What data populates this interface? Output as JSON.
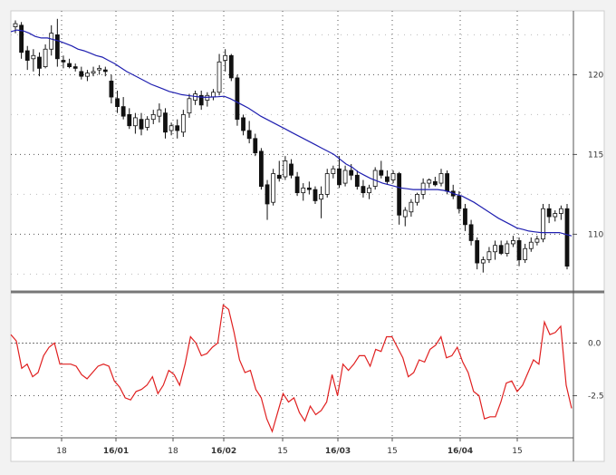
{
  "chart_data": [
    {
      "type": "candlestick",
      "panel": "price",
      "ylim": [
        106.5,
        124
      ],
      "y_ticks": [
        "120",
        "115",
        "110"
      ],
      "y_tick_values": [
        120,
        115,
        110
      ],
      "grid": true,
      "series": [
        {
          "name": "",
          "kind": "candles",
          "ohlc": [
            [
              123.0,
              123.4,
              122.6,
              123.2
            ],
            [
              123.1,
              123.3,
              121.0,
              121.4
            ],
            [
              121.5,
              121.8,
              120.3,
              120.9
            ],
            [
              121.0,
              121.6,
              120.2,
              121.2
            ],
            [
              121.1,
              121.4,
              119.9,
              120.4
            ],
            [
              120.5,
              121.9,
              120.4,
              121.6
            ],
            [
              121.6,
              123.1,
              121.2,
              122.6
            ],
            [
              122.5,
              123.5,
              120.5,
              121.0
            ],
            [
              120.9,
              121.2,
              120.4,
              120.8
            ],
            [
              120.7,
              121.0,
              120.4,
              120.5
            ],
            [
              120.5,
              120.7,
              120.2,
              120.4
            ],
            [
              120.2,
              120.5,
              119.7,
              119.9
            ],
            [
              119.9,
              120.3,
              119.6,
              120.1
            ],
            [
              120.1,
              120.5,
              119.9,
              120.2
            ],
            [
              120.3,
              120.6,
              120.0,
              120.4
            ],
            [
              120.3,
              120.5,
              119.9,
              120.2
            ],
            [
              119.6,
              120.0,
              118.2,
              118.6
            ],
            [
              118.5,
              119.0,
              117.6,
              118.0
            ],
            [
              118.0,
              118.6,
              117.2,
              117.4
            ],
            [
              117.5,
              117.9,
              116.6,
              116.8
            ],
            [
              116.8,
              117.6,
              116.3,
              117.3
            ],
            [
              117.2,
              117.6,
              116.2,
              116.6
            ],
            [
              116.7,
              117.4,
              116.5,
              117.2
            ],
            [
              117.2,
              117.8,
              116.9,
              117.5
            ],
            [
              117.4,
              118.2,
              117.0,
              117.8
            ],
            [
              117.6,
              117.9,
              116.0,
              116.4
            ],
            [
              116.5,
              117.0,
              116.2,
              116.8
            ],
            [
              116.8,
              117.2,
              116.0,
              116.5
            ],
            [
              116.4,
              117.8,
              116.1,
              117.5
            ],
            [
              117.6,
              118.8,
              117.3,
              118.5
            ],
            [
              118.4,
              119.0,
              118.1,
              118.8
            ],
            [
              118.7,
              119.0,
              117.8,
              118.1
            ],
            [
              118.4,
              118.9,
              118.0,
              118.7
            ],
            [
              118.6,
              119.1,
              118.4,
              118.9
            ],
            [
              118.9,
              121.3,
              118.7,
              120.8
            ],
            [
              120.9,
              121.6,
              120.2,
              121.2
            ],
            [
              121.2,
              121.3,
              119.6,
              119.8
            ],
            [
              119.8,
              120.0,
              116.8,
              117.2
            ],
            [
              117.3,
              117.5,
              116.2,
              116.5
            ],
            [
              116.5,
              117.1,
              115.7,
              116.0
            ],
            [
              116.0,
              116.3,
              114.9,
              115.1
            ],
            [
              115.2,
              115.4,
              112.8,
              113.0
            ],
            [
              113.1,
              113.4,
              110.9,
              111.9
            ],
            [
              112.0,
              114.1,
              111.8,
              113.8
            ],
            [
              113.7,
              114.6,
              113.3,
              113.5
            ],
            [
              113.6,
              114.9,
              113.4,
              114.6
            ],
            [
              114.4,
              114.7,
              113.5,
              113.7
            ],
            [
              113.6,
              113.9,
              112.4,
              112.6
            ],
            [
              112.6,
              113.2,
              112.1,
              112.9
            ],
            [
              112.9,
              113.3,
              112.5,
              112.8
            ],
            [
              112.8,
              113.0,
              111.9,
              112.1
            ],
            [
              112.2,
              113.0,
              111.0,
              112.5
            ],
            [
              112.5,
              114.1,
              112.3,
              113.8
            ],
            [
              113.8,
              114.3,
              113.5,
              114.1
            ],
            [
              114.1,
              114.9,
              112.9,
              113.1
            ],
            [
              113.2,
              114.3,
              113.0,
              114.0
            ],
            [
              114.0,
              114.4,
              113.4,
              113.7
            ],
            [
              113.7,
              114.0,
              112.8,
              113.0
            ],
            [
              113.0,
              113.4,
              112.3,
              112.6
            ],
            [
              112.6,
              113.1,
              112.2,
              112.9
            ],
            [
              113.0,
              114.2,
              112.8,
              114.0
            ],
            [
              114.0,
              114.6,
              113.5,
              113.7
            ],
            [
              113.6,
              114.0,
              113.1,
              113.3
            ],
            [
              113.4,
              114.0,
              113.2,
              113.8
            ],
            [
              113.8,
              113.9,
              110.6,
              111.2
            ],
            [
              111.1,
              111.7,
              110.5,
              111.5
            ],
            [
              111.4,
              112.2,
              111.1,
              112.0
            ],
            [
              112.0,
              112.6,
              111.8,
              112.5
            ],
            [
              112.5,
              113.5,
              112.2,
              113.2
            ],
            [
              113.2,
              113.5,
              112.9,
              113.4
            ],
            [
              113.3,
              113.6,
              113.0,
              113.1
            ],
            [
              113.2,
              114.1,
              113.0,
              113.8
            ],
            [
              113.8,
              114.0,
              112.5,
              112.7
            ],
            [
              112.7,
              113.1,
              112.2,
              112.4
            ],
            [
              112.4,
              112.7,
              111.3,
              111.6
            ],
            [
              111.6,
              111.9,
              110.2,
              110.6
            ],
            [
              110.6,
              110.9,
              109.3,
              109.6
            ],
            [
              109.6,
              109.8,
              107.8,
              108.2
            ],
            [
              108.2,
              108.6,
              107.6,
              108.4
            ],
            [
              108.4,
              109.2,
              108.2,
              108.9
            ],
            [
              108.9,
              109.6,
              108.4,
              109.3
            ],
            [
              109.3,
              109.6,
              108.7,
              108.8
            ],
            [
              108.8,
              109.6,
              108.6,
              109.4
            ],
            [
              109.4,
              109.9,
              109.2,
              109.6
            ],
            [
              109.6,
              109.8,
              108.0,
              108.4
            ],
            [
              108.4,
              109.4,
              108.2,
              109.1
            ],
            [
              109.1,
              109.8,
              108.9,
              109.5
            ],
            [
              109.5,
              109.9,
              109.3,
              109.7
            ],
            [
              109.7,
              111.9,
              109.5,
              111.6
            ],
            [
              111.6,
              111.9,
              110.7,
              111.1
            ],
            [
              111.1,
              111.5,
              110.8,
              111.3
            ],
            [
              111.3,
              111.8,
              110.9,
              111.6
            ],
            [
              111.6,
              111.9,
              107.8,
              108.0
            ]
          ]
        },
        {
          "name": "",
          "kind": "line",
          "color": "#1f1fb0",
          "values": [
            122.7,
            122.8,
            122.75,
            122.6,
            122.4,
            122.3,
            122.3,
            122.2,
            122.1,
            121.95,
            121.8,
            121.6,
            121.5,
            121.35,
            121.2,
            121.1,
            120.9,
            120.7,
            120.45,
            120.2,
            120.0,
            119.8,
            119.6,
            119.4,
            119.25,
            119.1,
            118.95,
            118.85,
            118.75,
            118.7,
            118.65,
            118.6,
            118.58,
            118.6,
            118.62,
            118.65,
            118.5,
            118.3,
            118.1,
            117.9,
            117.65,
            117.4,
            117.2,
            117.0,
            116.8,
            116.6,
            116.4,
            116.2,
            116.0,
            115.8,
            115.6,
            115.4,
            115.2,
            115.0,
            114.7,
            114.4,
            114.2,
            113.9,
            113.7,
            113.5,
            113.35,
            113.2,
            113.1,
            113.0,
            112.9,
            112.85,
            112.8,
            112.8,
            112.8,
            112.8,
            112.8,
            112.75,
            112.65,
            112.5,
            112.4,
            112.2,
            112.0,
            111.75,
            111.5,
            111.25,
            111.0,
            110.8,
            110.6,
            110.4,
            110.3,
            110.2,
            110.15,
            110.1,
            110.1,
            110.1,
            110.1,
            110.0,
            109.9
          ]
        }
      ]
    },
    {
      "type": "line",
      "panel": "oscillator",
      "ylim": [
        -4.5,
        2.3
      ],
      "y_ticks": [
        "0.0",
        "-2.5"
      ],
      "y_tick_values": [
        0.0,
        -2.5
      ],
      "grid": true,
      "series": [
        {
          "name": "",
          "color": "#e02020",
          "values": [
            0.4,
            0.1,
            -1.2,
            -1.0,
            -1.6,
            -1.4,
            -0.6,
            -0.2,
            0.0,
            -1.0,
            -1.0,
            -1.0,
            -1.1,
            -1.5,
            -1.7,
            -1.4,
            -1.1,
            -1.0,
            -1.1,
            -1.8,
            -2.1,
            -2.6,
            -2.7,
            -2.3,
            -2.2,
            -2.0,
            -1.6,
            -2.4,
            -2.0,
            -1.3,
            -1.5,
            -2.0,
            -1.0,
            0.3,
            0.0,
            -0.6,
            -0.5,
            -0.2,
            0.0,
            1.8,
            1.6,
            0.5,
            -0.8,
            -1.4,
            -1.3,
            -2.2,
            -2.6,
            -3.6,
            -4.2,
            -3.3,
            -2.4,
            -2.8,
            -2.6,
            -3.3,
            -3.7,
            -3.0,
            -3.4,
            -3.2,
            -2.8,
            -1.5,
            -2.5,
            -1.0,
            -1.3,
            -1.0,
            -0.6,
            -0.6,
            -1.1,
            -0.3,
            -0.4,
            0.3,
            0.3,
            -0.2,
            -0.7,
            -1.6,
            -1.4,
            -0.8,
            -0.9,
            -0.3,
            -0.1,
            0.3,
            -0.7,
            -0.6,
            -0.2,
            -0.9,
            -1.4,
            -2.3,
            -2.5,
            -3.6,
            -3.5,
            -3.5,
            -2.8,
            -1.9,
            -1.8,
            -2.3,
            -2.0,
            -1.4,
            -0.8,
            -1.0,
            1.0,
            0.4,
            0.5,
            0.8,
            -2.0,
            -3.1
          ]
        }
      ]
    }
  ],
  "x_tick_labels": [
    "18",
    "16/01",
    "18",
    "16/02",
    "15",
    "16/03",
    "15",
    "16/04",
    "15"
  ],
  "x_tick_label_bold": [
    false,
    true,
    false,
    true,
    false,
    true,
    false,
    true,
    false
  ],
  "x_tick_index": [
    8,
    17,
    26,
    35,
    44,
    53,
    62,
    71,
    80
  ]
}
